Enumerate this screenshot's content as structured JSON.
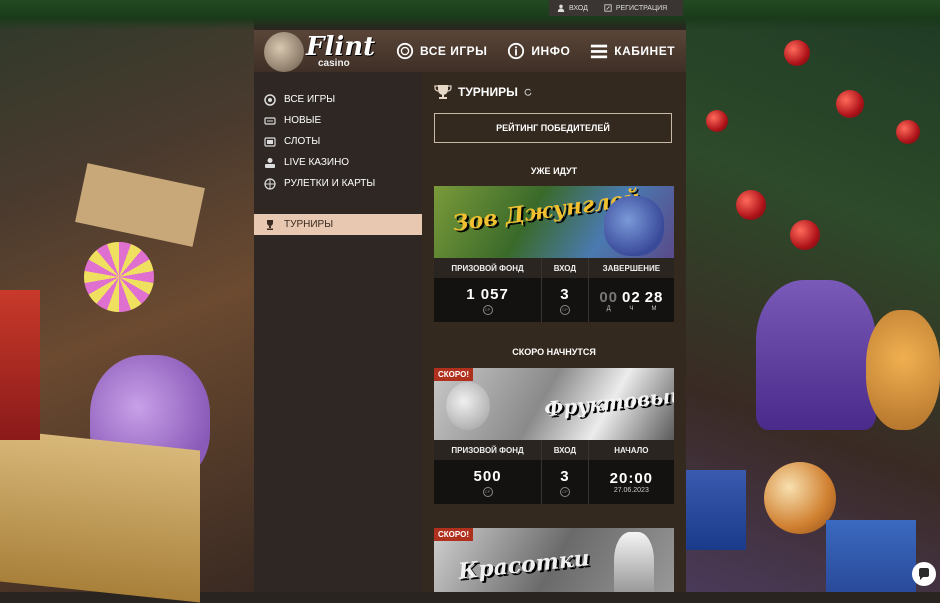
{
  "auth": {
    "login": "ВХОД",
    "register": "РЕГИСТРАЦИЯ"
  },
  "logo": {
    "word": "Flint",
    "sub": "casino"
  },
  "nav": [
    {
      "label": "ВСЕ ИГРЫ",
      "icon": "chip-icon"
    },
    {
      "label": "ИНФО",
      "icon": "info-icon"
    },
    {
      "label": "КАБИНЕТ",
      "icon": "menu-icon"
    }
  ],
  "sidebar": {
    "items": [
      {
        "label": "ВСЕ ИГРЫ",
        "icon": "chip-icon"
      },
      {
        "label": "НОВЫЕ",
        "icon": "new-icon"
      },
      {
        "label": "СЛОТЫ",
        "icon": "slot-icon"
      },
      {
        "label": "LIVE КАЗИНО",
        "icon": "dealer-icon"
      },
      {
        "label": "РУЛЕТКИ И КАРТЫ",
        "icon": "roulette-icon"
      },
      {
        "label": "ТУРНИРЫ",
        "icon": "trophy-icon"
      }
    ]
  },
  "main": {
    "title": "ТУРНИРЫ",
    "rating_button": "РЕЙТИНГ ПОБЕДИТЕЛЕЙ",
    "section_running": "УЖЕ ИДУТ",
    "section_soon": "СКОРО НАЧНУТСЯ",
    "currency": "СР"
  },
  "cards": [
    {
      "banner_title": "Зов Джунглей",
      "headers": {
        "prize": "ПРИЗОВОЙ ФОНД",
        "entry": "ВХОД",
        "end": "ЗАВЕРШЕНИЕ"
      },
      "prize": "1 057",
      "entry": "3",
      "timer": {
        "d": "00",
        "h": "02",
        "m": "28",
        "d_unit": "Д",
        "h_unit": "Ч",
        "m_unit": "М"
      }
    },
    {
      "badge": "СКОРО!",
      "banner_title": "Фруктовый",
      "headers": {
        "prize": "ПРИЗОВОЙ ФОНД",
        "entry": "ВХОД",
        "start": "НАЧАЛО"
      },
      "prize": "500",
      "entry": "3",
      "start_time": "20:00",
      "start_date": "27.06.2023"
    },
    {
      "badge": "СКОРО!",
      "banner_title": "Красотки"
    }
  ],
  "colors": {
    "accent": "#e8c8b0",
    "badge": "#b0301e",
    "panel": "#33291f"
  }
}
